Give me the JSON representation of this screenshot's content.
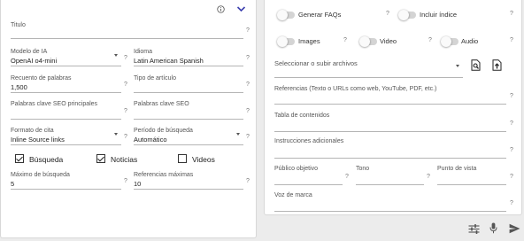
{
  "left": {
    "titulo": {
      "label": "Titulo",
      "value": ""
    },
    "modelo": {
      "label": "Modelo de IA",
      "value": "OpenAI o4-mini"
    },
    "idioma": {
      "label": "Idioma",
      "value": "Latin American Spanish"
    },
    "recuento": {
      "label": "Recuento de palabras",
      "value": "1,500"
    },
    "tipo": {
      "label": "Tipo de artículo",
      "value": ""
    },
    "kw_principales": {
      "label": "Palabras clave SEO principales",
      "value": ""
    },
    "kw_seo": {
      "label": "Palabras clave SEO",
      "value": ""
    },
    "formato": {
      "label": "Formato de cita",
      "value": "Inline Source links"
    },
    "periodo": {
      "label": "Período de búsqueda",
      "value": "Automático"
    },
    "checks": [
      {
        "label": "Búsqueda",
        "checked": true
      },
      {
        "label": "Noticias",
        "checked": true
      },
      {
        "label": "Videos",
        "checked": false
      }
    ],
    "max_busqueda": {
      "label": "Máximo de búsqueda",
      "value": "5"
    },
    "referencias_max": {
      "label": "Referencias máximas",
      "value": "10"
    },
    "help": "?"
  },
  "right": {
    "toggles": [
      {
        "label": "Generar FAQs",
        "on": false
      },
      {
        "label": "Incluir índice",
        "on": false
      },
      {
        "label": "Images",
        "on": false
      },
      {
        "label": "Video",
        "on": false
      },
      {
        "label": "Audio",
        "on": false
      }
    ],
    "archivos": {
      "label": "Seleccionar o subir archivos"
    },
    "referencias": {
      "label": "Referencias (Texto o URLs como web, YouTube, PDF, etc.)"
    },
    "tabla": {
      "label": "Tabla de contenidos"
    },
    "instrucciones": {
      "label": "Instrucciones adicionales"
    },
    "publico": {
      "label": "Público objetivo"
    },
    "tono": {
      "label": "Tono"
    },
    "punto": {
      "label": "Punto de vista"
    },
    "voz": {
      "label": "Voz de marca"
    },
    "help": "?"
  },
  "colors": {
    "accent": "#3b3fae",
    "help": "#777777"
  },
  "icons": [
    "info-icon",
    "chevron-down-icon",
    "file-search-icon",
    "file-upload-icon",
    "sliders-icon",
    "microphone-icon",
    "send-icon"
  ]
}
